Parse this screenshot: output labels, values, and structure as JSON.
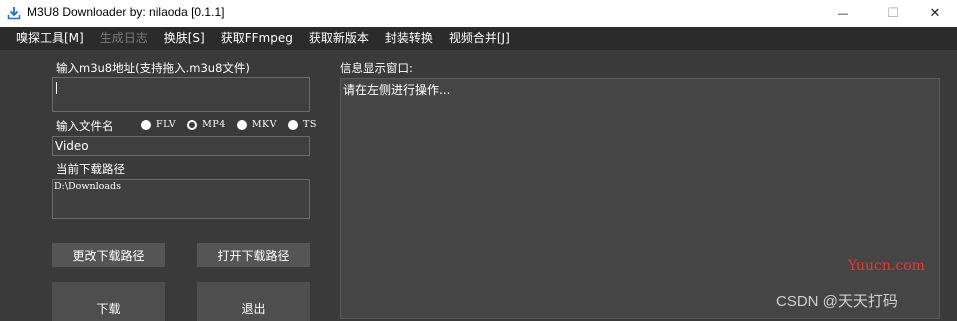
{
  "window": {
    "title": "M3U8 Downloader  by:  nilaoda [0.1.1]",
    "icon": "download-arrow-icon",
    "controls": {
      "minimize": "—",
      "maximize": "☐",
      "close": "✕"
    }
  },
  "menu": [
    {
      "label": "嗅探工具[M]",
      "disabled": false
    },
    {
      "label": "生成日志",
      "disabled": true
    },
    {
      "label": "换肤[S]",
      "disabled": false
    },
    {
      "label": "获取FFmpeg",
      "disabled": false
    },
    {
      "label": "获取新版本",
      "disabled": false
    },
    {
      "label": "封装转换",
      "disabled": false
    },
    {
      "label": "视频合并[J]",
      "disabled": false
    }
  ],
  "form": {
    "url_label": "输入m3u8地址(支持拖入.m3u8文件)",
    "url_value": "",
    "filename_label": "输入文件名",
    "formats": [
      {
        "label": "FLV",
        "checked": false
      },
      {
        "label": "MP4",
        "checked": true
      },
      {
        "label": "MKV",
        "checked": false
      },
      {
        "label": "TS",
        "checked": false
      }
    ],
    "filename_value": "Video",
    "path_label": "当前下载路径",
    "path_value": "D:\\Downloads"
  },
  "buttons": {
    "change_path": "更改下载路径",
    "open_path": "打开下载路径",
    "download": "下载",
    "exit": "退出"
  },
  "info": {
    "label": "信息显示窗口:",
    "text": "请在左侧进行操作..."
  },
  "watermarks": {
    "site": "Yuucn.com",
    "csdn": "CSDN @天天打码"
  },
  "colors": {
    "menubar_bg": "#2b2b2b",
    "panel_bg": "#3a3a3a",
    "button_bg": "#555555",
    "watermark_red": "#e23b2e"
  }
}
